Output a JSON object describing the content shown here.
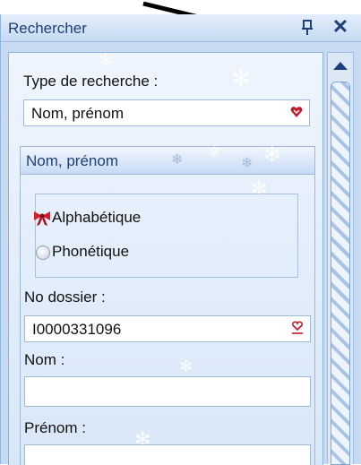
{
  "window": {
    "title": "Rechercher"
  },
  "search_type": {
    "label": "Type de recherche :",
    "value": "Nom, prénom"
  },
  "group": {
    "header": "Nom, prénom",
    "options": [
      {
        "label": "Alphabétique",
        "selected": true
      },
      {
        "label": "Phonétique",
        "selected": false
      }
    ]
  },
  "dossier": {
    "label": "No dossier :",
    "value": "I0000331096"
  },
  "nom": {
    "label": "Nom :",
    "value": ""
  },
  "prenom": {
    "label": "Prénom :",
    "value": ""
  },
  "icons": {
    "pin": "pin-icon",
    "close": "close-icon",
    "dropdown": "heart-dropdown-icon",
    "clear": "heart-clear-icon",
    "selected_option": "red-bow-icon",
    "scroll_up": "scroll-up-arrow-icon"
  },
  "colors": {
    "title_text": "#1e3f7a",
    "panel_bg": "#c7daf0",
    "heart": "#c0172a"
  }
}
